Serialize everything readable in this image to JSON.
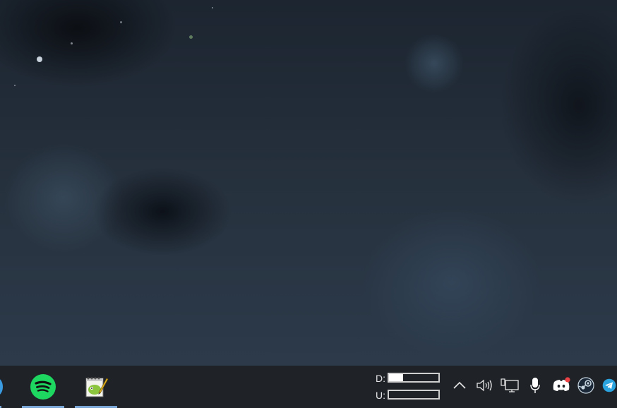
{
  "taskbar": {
    "apps": [
      {
        "name": "spotify",
        "icon": "spotify-icon",
        "running": true
      },
      {
        "name": "notepad++",
        "icon": "notepad-plus-plus-icon",
        "running": true
      }
    ],
    "net_meter": {
      "download_label": "D:",
      "upload_label": "U:",
      "download_level": 0.28,
      "upload_level": 0.0
    },
    "tray": {
      "icons": [
        "chevron-up-icon",
        "volume-icon",
        "network-icon",
        "microphone-icon",
        "discord-icon",
        "steam-icon",
        "telegram-icon"
      ]
    }
  },
  "colors": {
    "taskbar_bg": "#1f2328",
    "accent_underline": "#7aa6d6",
    "spotify_green": "#1ed760",
    "discord_badge": "#ed4245",
    "telegram_blue": "#2aa3df"
  }
}
